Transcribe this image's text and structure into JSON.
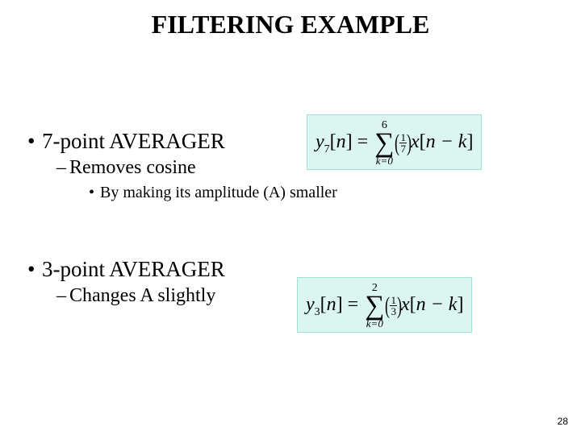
{
  "title": "FILTERING EXAMPLE",
  "items": [
    {
      "label": "7-point AVERAGER",
      "sub": {
        "label": "Removes cosine",
        "subsub": {
          "label": "By making its amplitude (A) smaller"
        }
      },
      "formula": {
        "y_sub": "7",
        "arg": "n",
        "sum_top": "6",
        "sum_bot": "k=0",
        "frac_num": "1",
        "frac_den": "7",
        "x_arg": "n − k"
      }
    },
    {
      "label": "3-point AVERAGER",
      "sub": {
        "label": "Changes A slightly"
      },
      "formula": {
        "y_sub": "3",
        "arg": "n",
        "sum_top": "2",
        "sum_bot": "k=0",
        "frac_num": "1",
        "frac_den": "3",
        "x_arg": "n − k"
      }
    }
  ],
  "page_number": "28"
}
